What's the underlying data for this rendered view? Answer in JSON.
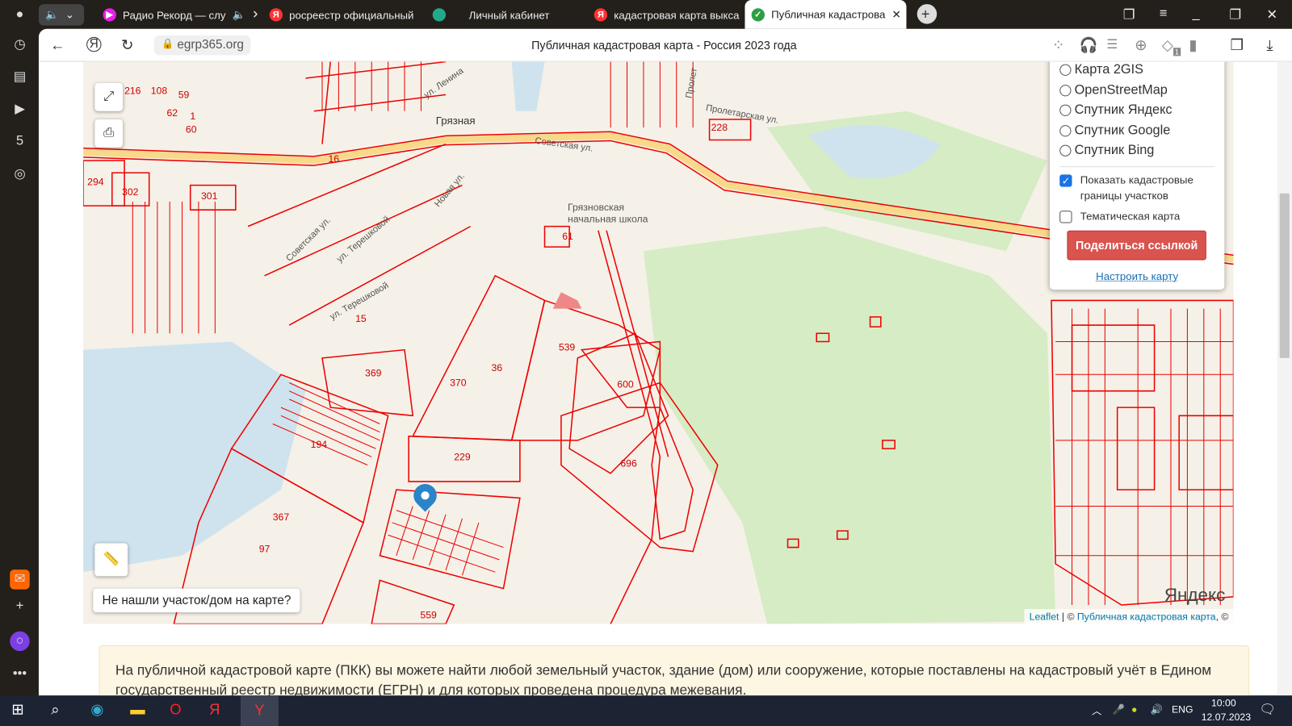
{
  "browser": {
    "tabs": [
      {
        "label": "Радио Рекорд — слу",
        "favicon": "play-icon",
        "color": "#e91ee9",
        "audio": true
      },
      {
        "label": "росреестр официальный",
        "favicon": "yandex-icon",
        "color": "#f33"
      },
      {
        "label": "Личный кабинет",
        "favicon": "rosreestr-icon",
        "color": "#2a8"
      },
      {
        "label": "кадастровая карта выкса",
        "favicon": "yandex-icon",
        "color": "#f33"
      },
      {
        "label": "Публичная кадастрова",
        "favicon": "check-icon",
        "color": "#2e9e44",
        "active": true
      }
    ],
    "url": "egrp365.org",
    "page_title": "Публичная кадастровая карта - Россия 2023 года",
    "ext_badge": "1"
  },
  "map": {
    "parcels": [
      "216",
      "108",
      "59",
      "62",
      "1",
      "60",
      "294",
      "302",
      "301",
      "228",
      "61",
      "539",
      "369",
      "370",
      "36",
      "600",
      "229",
      "194",
      "696",
      "367",
      "97",
      "559",
      "15",
      "16"
    ],
    "streets": [
      "ул. Ленина",
      "Грязная",
      "Советская ул.",
      "Пролетарская ул.",
      "Новая ул.",
      "Советская ул.",
      "ул. Терешковой",
      "ул. Терешковой",
      "Грязновская начальная школа",
      "Пролет"
    ],
    "not_found": "Не нашли участок/дом на карте?",
    "attribution": {
      "leaflet": "Leaflet",
      "sep": " | © ",
      "pkk": "Публичная кадастровая карта",
      "tail": ", ©"
    },
    "yandex_logo": "Яндекс"
  },
  "layers": {
    "base": [
      "Карта 2GIS",
      "OpenStreetMap",
      "Спутник Яндекс",
      "Спутник Google",
      "Спутник Bing"
    ],
    "show_borders": {
      "label": "Показать кадастровые границы участков",
      "checked": true
    },
    "thematic": {
      "label": "Тематическая карта",
      "checked": false
    },
    "share": "Поделиться ссылкой",
    "configure": "Настроить карту"
  },
  "info": "На публичной кадастровой карте (ПКК) вы можете найти любой земельный участок, здание (дом) или сооружение, которые поставлены на кадастровый учёт в Едином государственный реестр недвижимости (ЕГРН) и для которых проведена процедура межевания.",
  "taskbar": {
    "lang": "ENG",
    "time": "10:00",
    "date": "12.07.2023"
  }
}
